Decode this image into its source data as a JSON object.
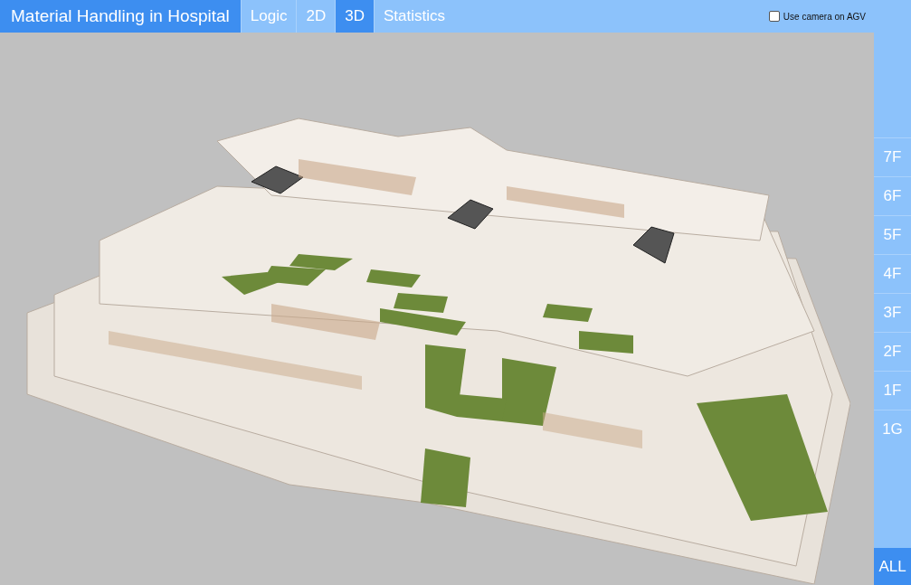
{
  "app_title": "Material Handling in Hospital",
  "tabs": [
    {
      "label": "Logic",
      "selected": false
    },
    {
      "label": "2D",
      "selected": false
    },
    {
      "label": "3D",
      "selected": true
    },
    {
      "label": "Statistics",
      "selected": false
    }
  ],
  "camera_option": {
    "label": "Use camera on AGV",
    "checked": false
  },
  "floors": [
    {
      "label": "7F",
      "selected": false
    },
    {
      "label": "6F",
      "selected": false
    },
    {
      "label": "5F",
      "selected": false
    },
    {
      "label": "4F",
      "selected": false
    },
    {
      "label": "3F",
      "selected": false
    },
    {
      "label": "2F",
      "selected": false
    },
    {
      "label": "1F",
      "selected": false
    },
    {
      "label": "1G",
      "selected": false
    }
  ],
  "all_button": {
    "label": "ALL",
    "selected": true
  }
}
